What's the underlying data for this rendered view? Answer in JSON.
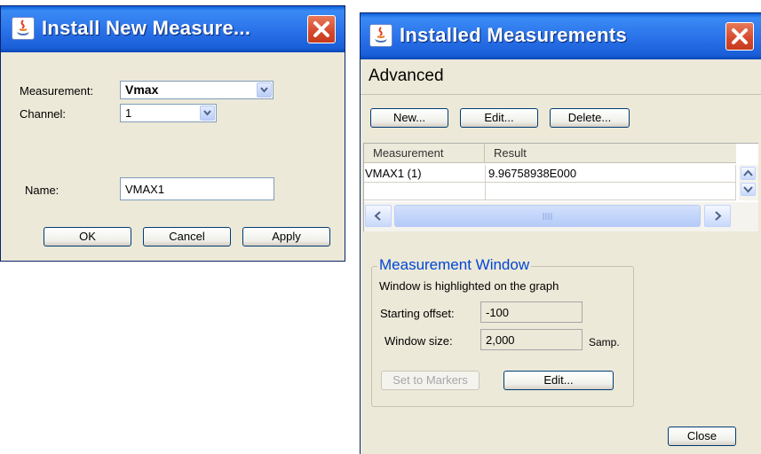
{
  "colors": {
    "titlebar": "#2b74ea",
    "dialog_bg": "#ece9d8",
    "group_title": "#0046d5",
    "close": "#d5482b"
  },
  "install_dialog": {
    "title": "Install New Measure...",
    "measurement_label": "Measurement:",
    "measurement_value": "Vmax",
    "channel_label": "Channel:",
    "channel_value": "1",
    "name_label": "Name:",
    "name_value": "VMAX1",
    "buttons": {
      "ok": "OK",
      "cancel": "Cancel",
      "apply": "Apply"
    },
    "icons": {
      "app": "java-icon",
      "close": "close-icon"
    }
  },
  "installed_dialog": {
    "title": "Installed Measurements",
    "section": "Advanced",
    "buttons": {
      "new": "New...",
      "edit": "Edit...",
      "delete": "Delete..."
    },
    "table": {
      "headers": [
        "Measurement",
        "Result"
      ],
      "rows": [
        [
          "VMAX1 (1)",
          "9.96758938E000"
        ]
      ]
    },
    "window_group": {
      "title": "Measurement Window",
      "description": "Window is highlighted on the graph",
      "starting_offset_label": "Starting offset:",
      "starting_offset_value": "-100",
      "window_size_label": "Window size:",
      "window_size_value": "2,000",
      "window_size_unit": "Samp.",
      "set_to_markers": "Set to Markers",
      "edit": "Edit..."
    },
    "close_button": "Close"
  }
}
